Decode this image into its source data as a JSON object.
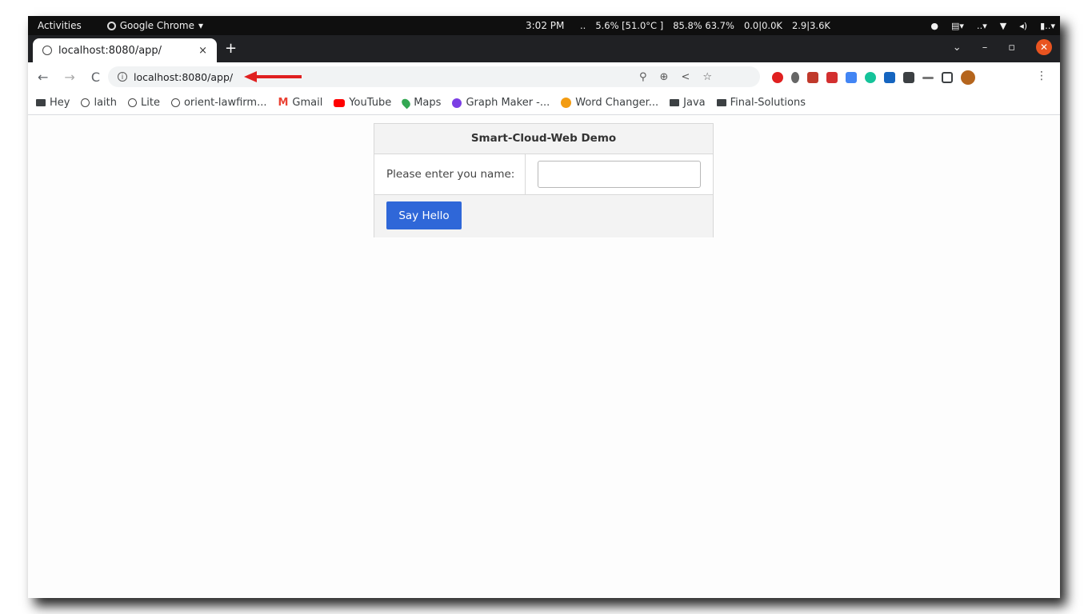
{
  "topbar": {
    "activities": "Activities",
    "app_name": "Google Chrome",
    "clock": "3:02 PM",
    "stats": [
      "..",
      "5.6% [51.0°C ]",
      "85.8% 63.7%",
      "0.0|0.0K",
      "2.9|3.6K"
    ]
  },
  "tab": {
    "title": "localhost:8080/app/",
    "close": "×",
    "new_tab": "+"
  },
  "toolbar": {
    "url": "localhost:8080/app/"
  },
  "bookmarks": [
    {
      "label": "Hey",
      "icon": "folder-icon"
    },
    {
      "label": "laith",
      "icon": "globe-icon"
    },
    {
      "label": "Lite",
      "icon": "globe-icon"
    },
    {
      "label": "orient-lawfirm...",
      "icon": "globe-icon"
    },
    {
      "label": "Gmail",
      "icon": "gmail-icon"
    },
    {
      "label": "YouTube",
      "icon": "youtube-icon"
    },
    {
      "label": "Maps",
      "icon": "maps-icon"
    },
    {
      "label": "Graph Maker -...",
      "icon": "graph-maker-icon"
    },
    {
      "label": "Word Changer...",
      "icon": "word-changer-icon"
    },
    {
      "label": "Java",
      "icon": "folder-icon"
    },
    {
      "label": "Final-Solutions",
      "icon": "folder-icon"
    }
  ],
  "form": {
    "title": "Smart-Cloud-Web Demo",
    "name_label": "Please enter you name:",
    "name_value": "",
    "button_label": "Say Hello"
  },
  "colors": {
    "accent_button": "#2f67d8",
    "annotation_arrow": "#e02020",
    "close_window": "#e95420"
  }
}
